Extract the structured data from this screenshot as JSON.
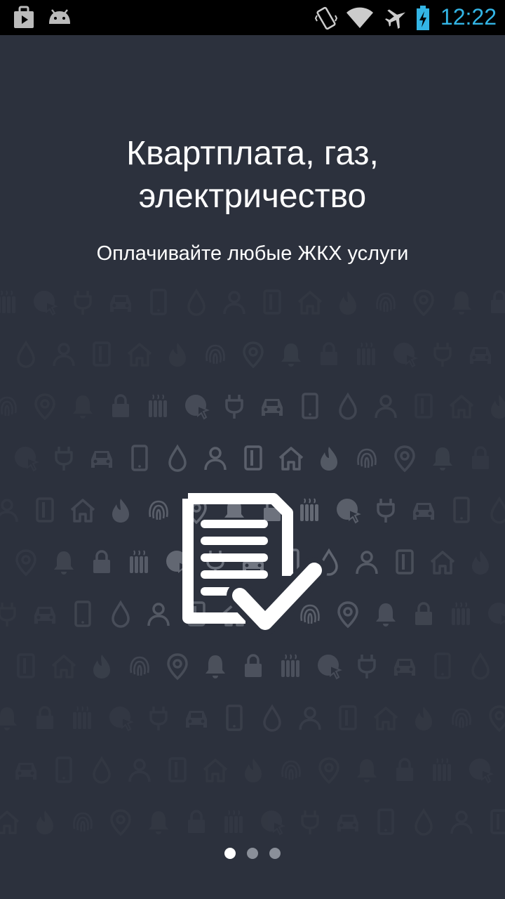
{
  "status_bar": {
    "time": "12:22",
    "accent_color": "#33b5e5",
    "icons_left": [
      "media-play-icon",
      "android-icon"
    ],
    "icons_right": [
      "vibrate-icon",
      "wifi-icon",
      "airplane-mode-icon",
      "battery-charging-icon"
    ]
  },
  "onboarding": {
    "title": "Квартплата, газ, электричество",
    "subtitle": "Оплачивайте любые ЖКХ услуги",
    "hero_icon": "document-check-icon",
    "background_icons": [
      "home-icon",
      "fire-icon",
      "fingerprint-icon",
      "location-pin-icon",
      "bell-icon",
      "lock-icon",
      "radiator-icon",
      "globe-cursor-icon",
      "plug-icon",
      "car-icon",
      "phone-icon",
      "water-drop-icon",
      "person-icon",
      "card-icon"
    ],
    "background_color": "#2c313d",
    "pager": {
      "count": 3,
      "active_index": 0
    }
  }
}
